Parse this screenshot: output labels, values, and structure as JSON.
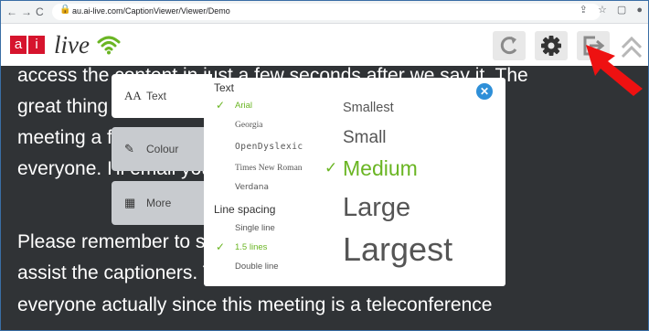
{
  "browser": {
    "back": "←",
    "forward": "→",
    "reload": "C",
    "lock": "🔒",
    "url": "au.ai-live.com/CaptionViewer/Viewer/Demo",
    "share_icon": "⇪",
    "star_icon": "☆",
    "window_icon": "▢",
    "profile_icon": "●"
  },
  "logo": {
    "box1": "a",
    "box2": "i",
    "live": "live"
  },
  "header_buttons": [
    "refresh-icon",
    "gear-icon",
    "exit-icon",
    "chevron-up-icon"
  ],
  "captions": [
    "access the content in just a few seconds after we say it. The",
    "great thing about this is you will get a transcript of the",
    "meeting a few minutes after we finish. minutes for",
    "everyone. I'll email you the details tomorrow.",
    "Please remember to speak clearly while you speak to",
    "assist the captioners. This is also just as useful for",
    "everyone actually since this meeting is a teleconference"
  ],
  "tabs": [
    {
      "icon": "AA",
      "label": "Text"
    },
    {
      "icon": "✎",
      "label": "Colour"
    },
    {
      "icon": "▦",
      "label": "More"
    }
  ],
  "panel": {
    "text_title": "Text",
    "fonts": [
      "Arial",
      "Georgia",
      "OpenDyslexic",
      "Times New Roman",
      "Verdana"
    ],
    "selected_font": "Arial",
    "spacing_title": "Line spacing",
    "spacings": [
      "Single line",
      "1.5 lines",
      "Double line"
    ],
    "selected_spacing": "1.5 lines",
    "sizes": [
      "Smallest",
      "Small",
      "Medium",
      "Large",
      "Largest"
    ],
    "selected_size": "Medium",
    "check": "✓",
    "close": "✕"
  },
  "colors": {
    "accent": "#6ab523",
    "brand": "#d6142d",
    "close": "#2e8fd8",
    "arrow": "#ee1111"
  }
}
